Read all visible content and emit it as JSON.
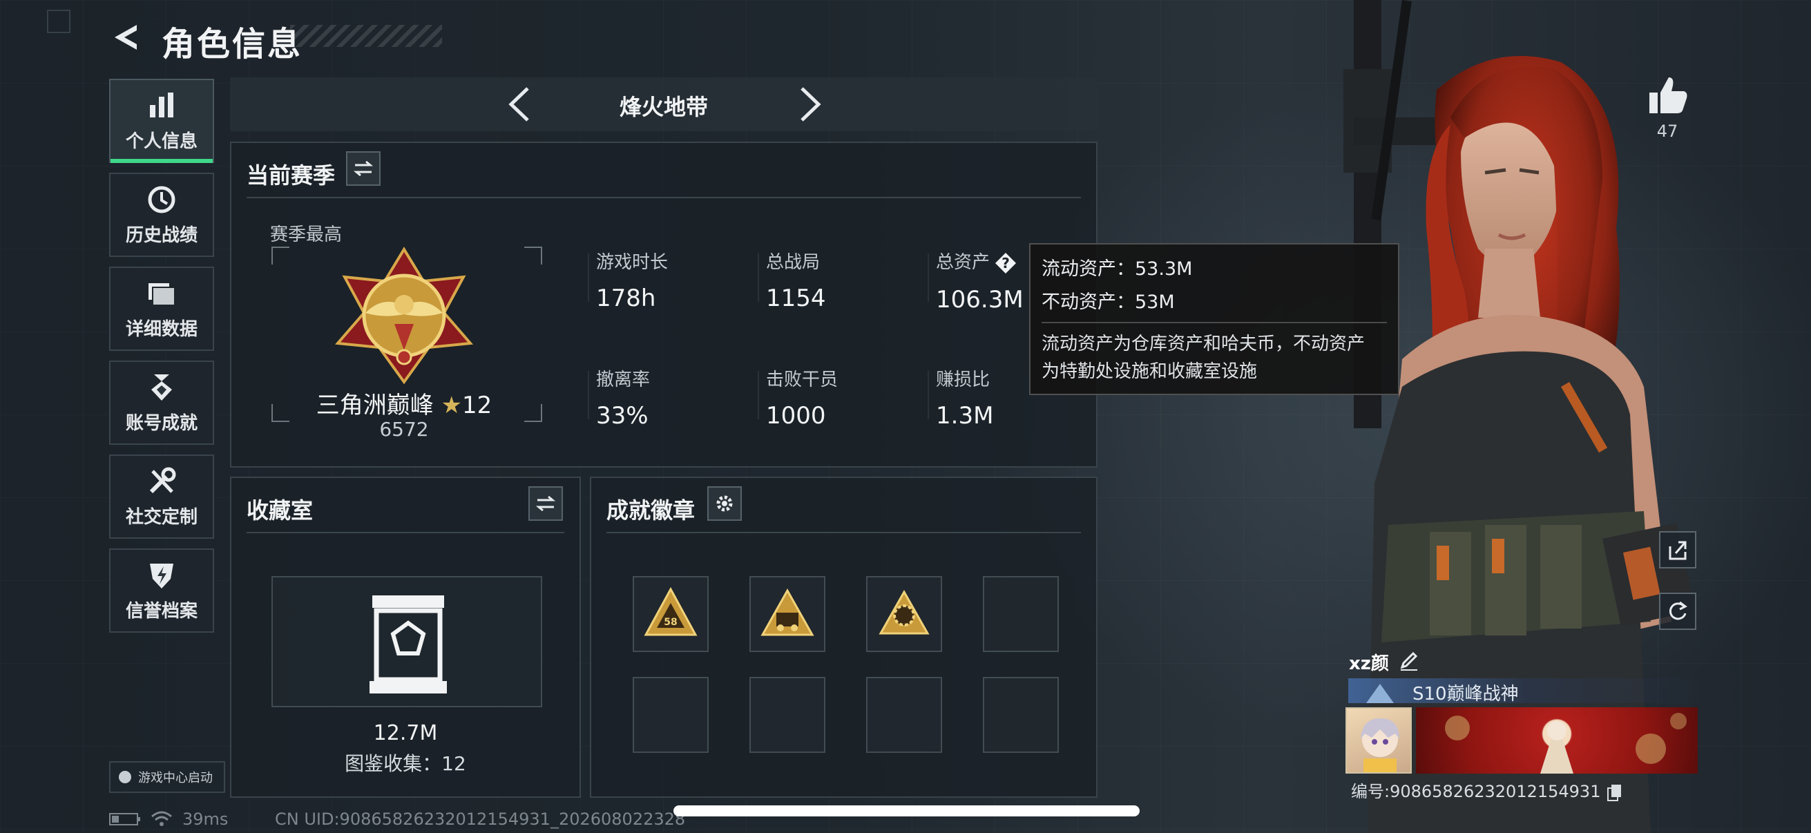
{
  "header": {
    "title": "角色信息"
  },
  "sidebar": {
    "items": [
      {
        "label": "个人信息",
        "icon": "bar-chart-icon",
        "active": true
      },
      {
        "label": "历史战绩",
        "icon": "history-icon"
      },
      {
        "label": "详细数据",
        "icon": "folder-icon"
      },
      {
        "label": "账号成就",
        "icon": "medal-icon"
      },
      {
        "label": "社交定制",
        "icon": "tools-icon"
      },
      {
        "label": "信誉档案",
        "icon": "shield-icon"
      }
    ],
    "launch_label": "游戏中心启动"
  },
  "mode_bar": {
    "title": "烽火地带"
  },
  "season_panel": {
    "title": "当前赛季",
    "season_best_label": "赛季最高",
    "rank_name": "三角洲巅峰",
    "rank_stars": "12",
    "rank_score": "6572",
    "stats": [
      {
        "label": "游戏时长",
        "value": "178h"
      },
      {
        "label": "总战局",
        "value": "1154"
      },
      {
        "label": "总资产",
        "value": "106.3M"
      },
      {
        "label": "撤离率",
        "value": "33%"
      },
      {
        "label": "击败干员",
        "value": "1000"
      },
      {
        "label": "赚损比",
        "value": "1.3M"
      }
    ]
  },
  "tooltip": {
    "liquid": "流动资产：53.3M",
    "fixed": "不动资产：53M",
    "desc_line1": "流动资产为仓库资产和哈夫币，不动资产",
    "desc_line2": "为特勤处设施和收藏室设施"
  },
  "collection_panel": {
    "title": "收藏室",
    "value": "12.7M",
    "catalog": "图鉴收集：12"
  },
  "badges_panel": {
    "title": "成就徽章",
    "badges": [
      {
        "icon": "badge-58-icon",
        "text": "58"
      },
      {
        "icon": "badge-vehicle-icon"
      },
      {
        "icon": "badge-gear-icon"
      }
    ],
    "empty_slots": 5
  },
  "likes": {
    "count": "47"
  },
  "player": {
    "name": "xz颜",
    "title": "S10巅峰战神",
    "uid_label": "编号:90865826232012154931"
  },
  "status": {
    "ping": "39ms",
    "cn_uid": "CN UID:90865826232012154931_202608022328"
  },
  "colors": {
    "accent": "#3fd88a",
    "gold": "#c99a3a"
  }
}
